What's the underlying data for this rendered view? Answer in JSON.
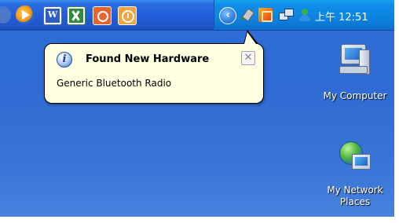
{
  "taskbar": {
    "quick_launch": [
      {
        "name": "partial-icon"
      },
      {
        "name": "media-player-icon"
      },
      {
        "name": "word-icon",
        "glyph": "W"
      },
      {
        "name": "excel-icon"
      },
      {
        "name": "powerpoint-icon"
      },
      {
        "name": "clock-app-icon"
      }
    ]
  },
  "tray": {
    "expand_glyph": "‹",
    "icons": [
      "hardware-icon",
      "ime-icon",
      "network-icon",
      "messenger-icon"
    ],
    "clock": "上午 12:51"
  },
  "balloon": {
    "info_glyph": "i",
    "title": "Found New Hardware",
    "close_glyph": "✕",
    "message": "Generic Bluetooth Radio"
  },
  "desktop": {
    "icons": [
      {
        "label": "My Computer"
      },
      {
        "label_line1": "My Network",
        "label_line2": "Places"
      }
    ]
  },
  "colors": {
    "desktop": "#2f6bd3",
    "taskbar": "#245edb",
    "tray": "#0c84e0",
    "balloon_bg": "#ffffe1"
  }
}
